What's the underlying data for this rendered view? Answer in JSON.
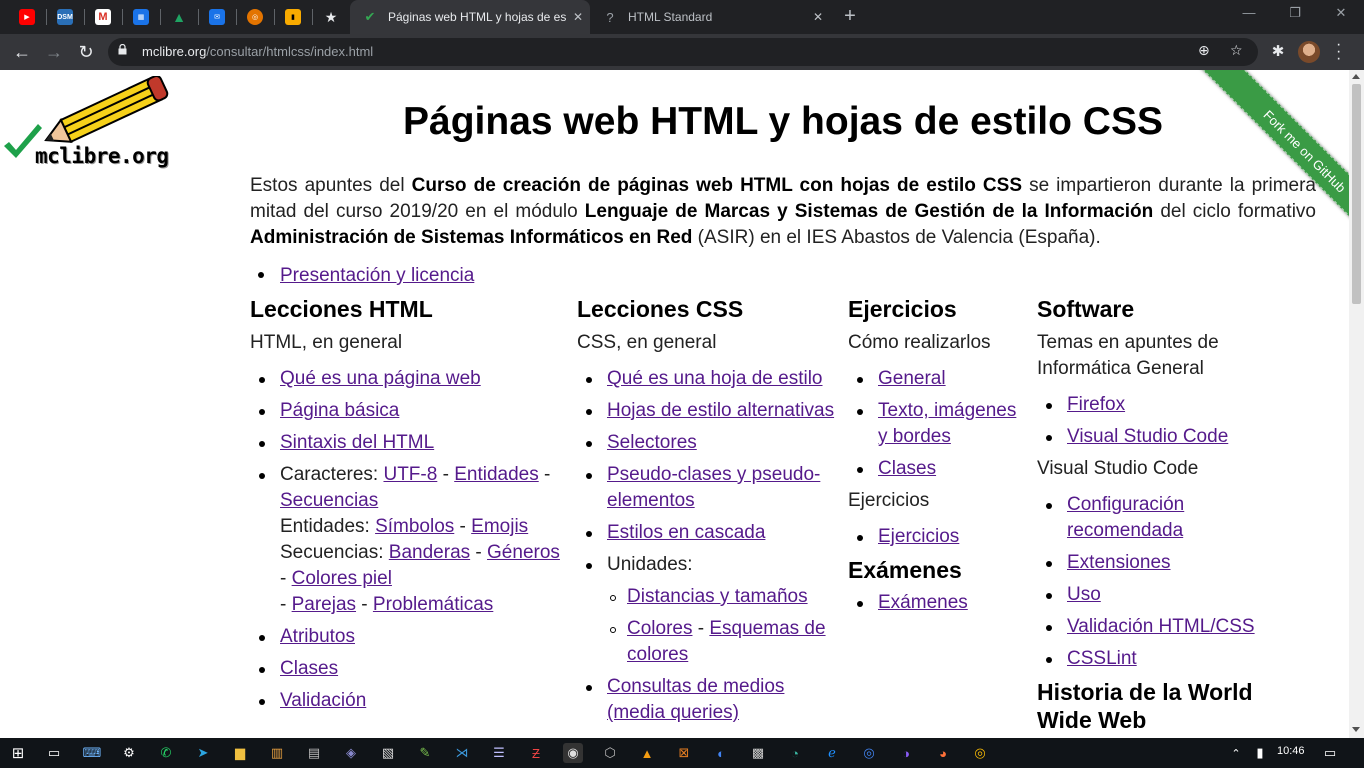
{
  "browser": {
    "pinned_tabs": [
      {
        "icon": "youtube-icon",
        "color": "#ff0000"
      },
      {
        "icon": "dsm-icon",
        "color": "#2a6fb7",
        "text": "DSM"
      },
      {
        "icon": "gmail-icon",
        "color": "#d93025"
      },
      {
        "icon": "calendar-icon",
        "color": "#1a73e8"
      },
      {
        "icon": "drive-icon",
        "color": "#1fa463"
      },
      {
        "icon": "mail-icon",
        "color": "#1a73e8"
      },
      {
        "icon": "chrome-web-store-icon",
        "color": "#e37400"
      },
      {
        "icon": "bookmark-manager-icon",
        "color": "#f9ab00"
      },
      {
        "icon": "star-icon",
        "color": "#e8eaed"
      }
    ],
    "tabs": [
      {
        "title": "Páginas web HTML y hojas de est",
        "favicon": "checkmark-icon",
        "active": true
      },
      {
        "title": "HTML Standard",
        "favicon": "question-icon",
        "active": false
      }
    ],
    "url_host": "mclibre.org",
    "url_path": "/consultar/htmlcss/index.html"
  },
  "page": {
    "logo_text": "mclibre.org",
    "ribbon_text": "Fork me on GitHub",
    "title": "Páginas web HTML y hojas de estilo CSS",
    "intro": {
      "p1": "Estos apuntes del ",
      "b1": "Curso de creación de páginas web HTML con hojas de estilo CSS",
      "p2": " se impartieron durante la primera mitad del curso 2019/20 en el módulo ",
      "b2": "Lenguaje de Marcas y Sistemas de Gestión de la Información",
      "p3": " del ciclo formativo ",
      "b3": "Administración de Sistemas Informáticos en Red",
      "p4": " (ASIR) en el IES Abastos de Valencia (España)."
    },
    "presentacion": "Presentación y licencia",
    "html": {
      "heading": "Lecciones HTML",
      "sub": "HTML, en general",
      "l1": "Qué es una página web",
      "l2": "Página básica",
      "l3": "Sintaxis del HTML",
      "car_label": "Caracteres: ",
      "utf8": "UTF-8",
      "entidades": "Entidades",
      "secuencias": "Secuencias",
      "ent_label": "Entidades: ",
      "simbolos": "Símbolos",
      "emojis": "Emojis",
      "sec_label": "Secuencias: ",
      "banderas": "Banderas",
      "generos": "Géneros",
      "colores_piel": "Colores piel",
      "parejas": "Parejas",
      "problematicas": "Problemáticas",
      "sep": " - ",
      "atributos": "Atributos",
      "clases": "Clases",
      "validacion": "Validación"
    },
    "css": {
      "heading": "Lecciones CSS",
      "sub": "CSS, en general",
      "l1": "Qué es una hoja de estilo",
      "l2": "Hojas de estilo alternativas",
      "l3": "Selectores",
      "l4": "Pseudo-clases y pseudo-elementos",
      "l5": "Estilos en cascada",
      "unidades": "Unidades:",
      "u1": "Distancias y tamaños",
      "u2a": "Colores",
      "u2b": "Esquemas de colores",
      "l6": "Consultas de medios (media queries)"
    },
    "ejercicios": {
      "heading": "Ejercicios",
      "sub": "Cómo realizarlos",
      "l1": "General",
      "l2": "Texto, imágenes y bordes",
      "l3": "Clases",
      "sub2": "Ejercicios",
      "l4": "Ejercicios",
      "heading2": "Exámenes",
      "l5": "Exámenes"
    },
    "software": {
      "heading": "Software",
      "sub": "Temas en apuntes de Informática General",
      "l1": "Firefox",
      "l2": "Visual Studio Code",
      "sub2": "Visual Studio Code",
      "l3": "Configuración recomendada",
      "l4": "Extensiones",
      "l5": "Uso",
      "l6": "Validación HTML/CSS",
      "l7": "CSSLint",
      "heading2": "Historia de la World Wide Web"
    }
  },
  "taskbar": {
    "clock": "10:46"
  }
}
